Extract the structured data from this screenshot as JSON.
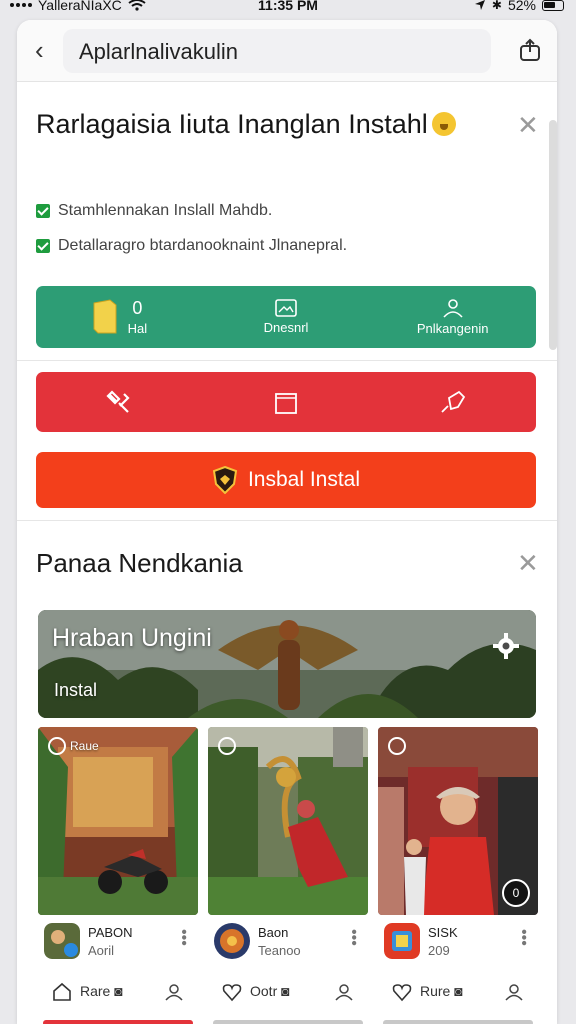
{
  "status_bar": {
    "carrier": "YalleraNIaXC",
    "time": "11:35 PM",
    "battery": "52%"
  },
  "app_bar": {
    "url_text": "Aplarlnalivakulin",
    "back_icon": "chevron-left-icon",
    "share_icon": "share-icon"
  },
  "dialog": {
    "title": "Rarlagaisia Iiuta Inanglan Instahl",
    "checklist": [
      "Stamhlennakan Inslall Mahdb.",
      "Detallaragro btardanooknaint Jlnanepral."
    ]
  },
  "green_bar": {
    "items": [
      {
        "icon": "folder-icon",
        "value": "0",
        "label": "Hal"
      },
      {
        "icon": "image-icon",
        "label": "Dnesnrl"
      },
      {
        "icon": "user-icon",
        "label": "Pnlkangenin"
      }
    ]
  },
  "red_bar": {
    "items": [
      {
        "icon": "tools-icon"
      },
      {
        "icon": "square-icon"
      },
      {
        "icon": "tag-icon"
      }
    ]
  },
  "install_button": {
    "label": "Insbal Instal",
    "icon": "shield-icon"
  },
  "section": {
    "title": "Panaa Nendkania",
    "banner": {
      "title": "Hraban Ungini",
      "subtitle": "Instal"
    }
  },
  "tiles": [
    {
      "badge": "Raue",
      "app_name": "PABON",
      "app_sub": "Aoril",
      "action": "Rare"
    },
    {
      "badge": "",
      "app_name": "Baon",
      "app_sub": "Teanoo",
      "action": "Ootr"
    },
    {
      "badge": "",
      "app_name": "SISK",
      "app_sub": "209",
      "action": "Rure"
    }
  ],
  "tile_overlay": {
    "count": "0"
  },
  "colors": {
    "green": "#2d9d75",
    "red": "#e3333a",
    "orange": "#f33f1b"
  }
}
